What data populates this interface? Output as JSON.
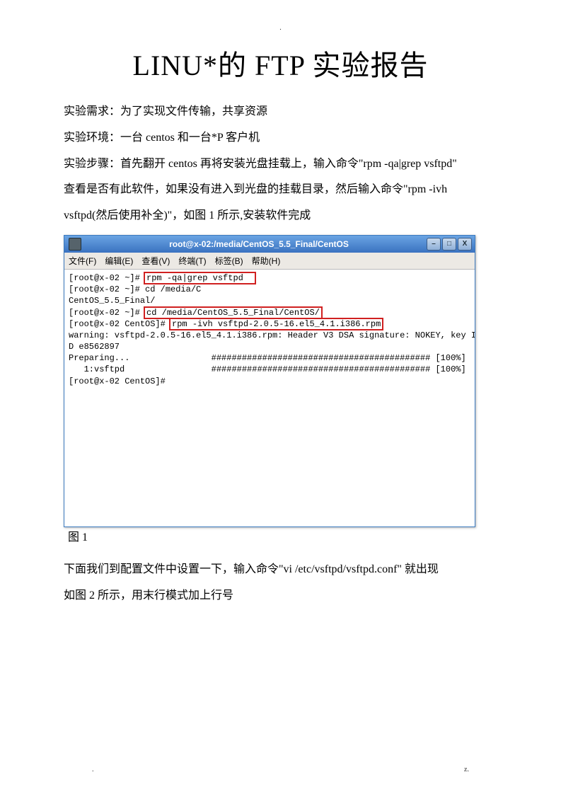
{
  "top_marker": ".",
  "title": "LINU*的 FTP 实验报告",
  "para1": "实验需求：为了实现文件传输，共享资源",
  "para2": "实验环境：一台 centos 和一台*P 客户机",
  "para3a": "实验步骤：首先翻开 centos 再将安装光盘挂载上，输入命令\"rpm  -qa|grep  vsftpd\"",
  "para3b": "查看是否有此软件，如果没有进入到光盘的挂载目录，然后输入命令\"rpm  -ivh",
  "para3c": "vsftpd(然后使用补全)\"，如图 1 所示,安装软件完成",
  "terminal": {
    "title": "root@x-02:/media/CentOS_5.5_Final/CentOS",
    "menu": {
      "file": "文件(F)",
      "edit": "编辑(E)",
      "view": "查看(V)",
      "term": "终端(T)",
      "tabs": "标签(B)",
      "help": "帮助(H)"
    },
    "win_btn_min": "–",
    "win_btn_max": "□",
    "win_btn_close": "X",
    "lines": {
      "l1a": "[root@x-02 ~]# ",
      "l1b": "rpm -qa|grep vsftpd  ",
      "l2": "[root@x-02 ~]# cd /media/C",
      "l3": "CentOS_5.5_Final/",
      "l4a": "[root@x-02 ~]# ",
      "l4b": "cd /media/CentOS_5.5_Final/CentOS/",
      "l5a": "[root@x-02 CentOS]# ",
      "l5b": "rpm -ivh vsftpd-2.0.5-16.el5_4.1.i386.rpm",
      "l6": "warning: vsftpd-2.0.5-16.el5_4.1.i386.rpm: Header V3 DSA signature: NOKEY, key I",
      "l7": "D e8562897",
      "l8": "Preparing...                ########################################### [100%]",
      "l9": "   1:vsftpd                 ########################################### [100%]",
      "l10": "[root@x-02 CentOS]# "
    }
  },
  "fig1_label": "图 1",
  "para4a": "下面我们到配置文件中设置一下，输入命令\"vi  /etc/vsftpd/vsftpd.conf\" 就出现",
  "para4b": "如图 2 所示，用末行模式加上行号",
  "footer_dot": ".",
  "footer_z": "z."
}
